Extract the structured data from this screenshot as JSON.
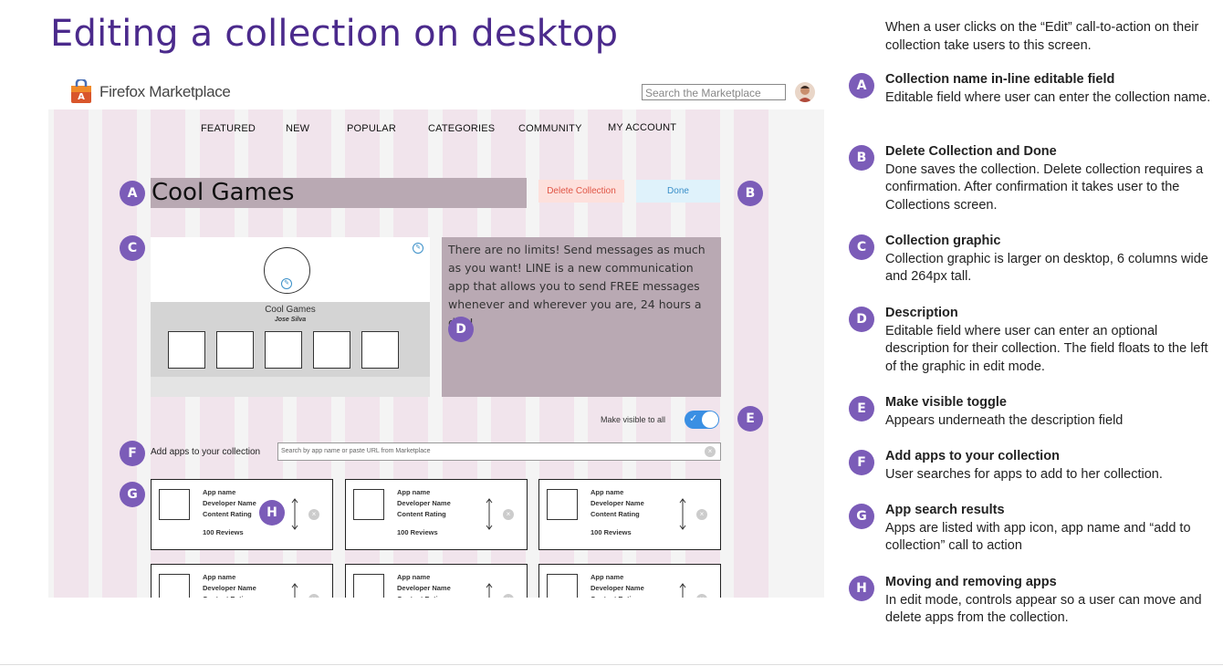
{
  "page_title": "Editing a collection on desktop",
  "mockup": {
    "logo_text": "Firefox Marketplace",
    "search_placeholder": "Search the Marketplace",
    "nav": [
      "FEATURED",
      "NEW",
      "POPULAR",
      "CATEGORIES",
      "COMMUNITY",
      "MY ACCOUNT"
    ],
    "collection_title": "Cool Games",
    "delete_label": "Delete Collection",
    "done_label": "Done",
    "graphic": {
      "name": "Cool Games",
      "author": "Jose Silva"
    },
    "description": "There are no limits! Send messages as much as you want! LINE is a new communication app that allows you to send FREE messages whenever and wherever you are, 24 hours a day!",
    "visible_label": "Make visible to all",
    "visible_on": true,
    "add_label": "Add apps to your collection",
    "add_placeholder": "Search by app name or paste URL from Marketplace",
    "card": {
      "app_name": "App name",
      "developer": "Developer Name",
      "rating": "Content Rating",
      "reviews": "100 Reviews"
    },
    "badges": [
      "A",
      "B",
      "C",
      "D",
      "E",
      "F",
      "G",
      "H"
    ]
  },
  "notes": {
    "intro": "When a user clicks on the “Edit” call-to-action on their collection take users to this screen.",
    "items": [
      {
        "letter": "A",
        "title": "Collection name in-line editable field",
        "body": "Editable field where user can enter the collection name."
      },
      {
        "letter": "B",
        "title": "Delete Collection and Done",
        "body": "Done saves the collection. Delete collection requires a confirmation. After confirmation it takes user to the Collections screen."
      },
      {
        "letter": "C",
        "title": "Collection graphic",
        "body": "Collection graphic is larger on desktop, 6 columns wide and 264px tall."
      },
      {
        "letter": "D",
        "title": "Description",
        "body": "Editable field where user can enter an optional description for their collection. The field floats to the left of the graphic in edit mode."
      },
      {
        "letter": "E",
        "title": "Make visible toggle",
        "body": "Appears underneath the description field"
      },
      {
        "letter": "F",
        "title": "Add apps to your collection",
        "body": "User searches for apps to add to her collection."
      },
      {
        "letter": "G",
        "title": "App search results",
        "body": "Apps are listed with app icon, app name and “add to collection” call to action"
      },
      {
        "letter": "H",
        "title": "Moving and removing apps",
        "body": "In edit mode, controls appear so a user can move and delete apps from the collection."
      }
    ]
  },
  "colors": {
    "accent": "#7b5cb8",
    "title": "#4b2a8c",
    "column": "#f1e4ec",
    "field": "#b9a9b3",
    "toggle": "#3a8fe3"
  }
}
